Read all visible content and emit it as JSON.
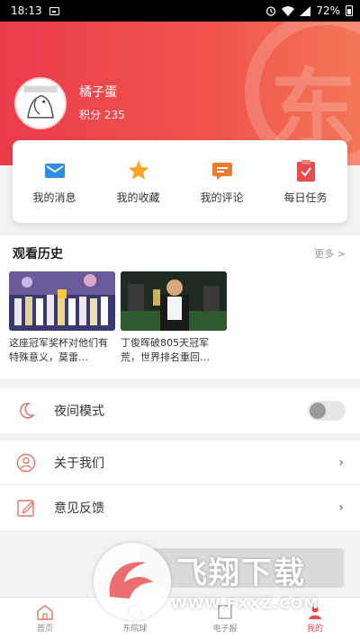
{
  "status_bar": {
    "time": "18:13",
    "battery": "72%"
  },
  "profile": {
    "username": "橘子蛋",
    "points": "积分 235",
    "watermark_char": "东"
  },
  "quick_menu": [
    {
      "label": "我的消息",
      "icon": "mail-icon",
      "color": "#2f8de4"
    },
    {
      "label": "我的收藏",
      "icon": "star-icon",
      "color": "#f5a623"
    },
    {
      "label": "我的评论",
      "icon": "comment-icon",
      "color": "#f07a2c"
    },
    {
      "label": "每日任务",
      "icon": "clipboard-icon",
      "color": "#e94a4a"
    }
  ],
  "history": {
    "title": "观看历史",
    "more": "更多 >",
    "videos": [
      {
        "caption": "这座冠军奖杯对他们有特殊意义，莫雷…"
      },
      {
        "caption": "丁俊晖破805天冠军荒，世界排名重回…"
      }
    ]
  },
  "settings": {
    "night_mode": {
      "label": "夜间模式",
      "enabled": false
    },
    "about": {
      "label": "关于我们"
    },
    "feedback": {
      "label": "意见反馈"
    }
  },
  "bottom_nav": [
    {
      "label": "首页",
      "icon": "home-icon",
      "active": false
    },
    {
      "label": "东院球",
      "icon": "ball-icon",
      "active": false
    },
    {
      "label": "电子报",
      "icon": "newspaper-icon",
      "active": false
    },
    {
      "label": "我的",
      "icon": "user-icon",
      "active": true
    }
  ],
  "overlay": {
    "brand": "飞翔下载",
    "domain": "WWW.FXXZ.COM"
  },
  "colors": {
    "accent": "#eb3b4b",
    "icon_red": "#e57361"
  }
}
